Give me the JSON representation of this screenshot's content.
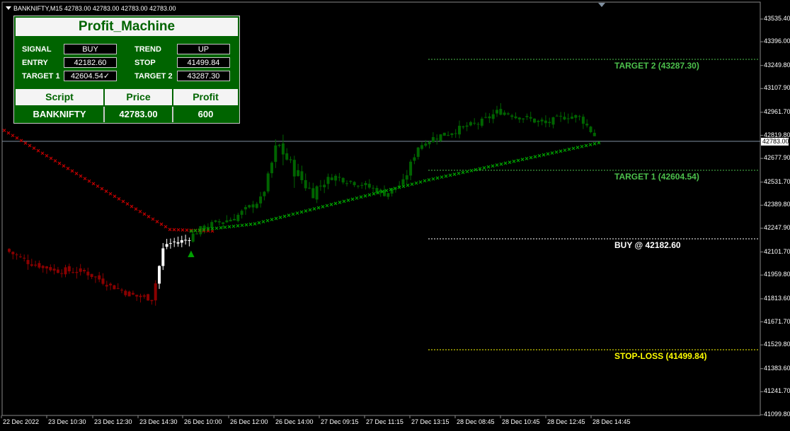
{
  "header": {
    "symbol_info": "BANKNIFTY,M15  42783.00 42783.00 42783.00 42783.00"
  },
  "panel": {
    "title": "Profit_Machine",
    "signal_label": "SIGNAL",
    "signal_value": "BUY",
    "trend_label": "TREND",
    "trend_value": "UP",
    "entry_label": "ENTRY",
    "entry_value": "42182.60",
    "stop_label": "STOP",
    "stop_value": "41499.84",
    "target1_label": "TARGET 1",
    "target1_value": "42604.54✓",
    "target2_label": "TARGET 2",
    "target2_value": "43287.30",
    "table": {
      "headers": [
        "Script",
        "Price",
        "Profit"
      ],
      "row": [
        "BANKNIFTY",
        "42783.00",
        "600"
      ]
    }
  },
  "levels": {
    "target2": {
      "label": "TARGET 2 (43287.30)",
      "price": 43287.3,
      "color": "#4cc04c"
    },
    "target1": {
      "label": "TARGET 1 (42604.54)",
      "price": 42604.54,
      "color": "#4cc04c"
    },
    "buy": {
      "label": "BUY @ 42182.60",
      "price": 42182.6,
      "color": "#ffffff"
    },
    "stop": {
      "label": "STOP-LOSS (41499.84)",
      "price": 41499.84,
      "color": "#ffff00"
    }
  },
  "current_price": {
    "label": "42783.00",
    "value": 42783.0
  },
  "y_axis": {
    "labels": [
      "43535.40",
      "43396.00",
      "43249.80",
      "43107.90",
      "42961.70",
      "42819.80",
      "42677.90",
      "42531.70",
      "42389.80",
      "42247.90",
      "42101.70",
      "41959.80",
      "41813.60",
      "41671.70",
      "41529.80",
      "41383.60",
      "41241.70",
      "41099.80"
    ],
    "min": 41099.8,
    "max": 43535.4
  },
  "x_axis": {
    "labels": [
      "22 Dec 2022",
      "23 Dec 10:30",
      "23 Dec 12:30",
      "23 Dec 14:30",
      "26 Dec 10:00",
      "26 Dec 12:00",
      "26 Dec 14:00",
      "27 Dec 09:15",
      "27 Dec 11:15",
      "27 Dec 13:15",
      "28 Dec 08:45",
      "28 Dec 10:45",
      "28 Dec 12:45",
      "28 Dec 14:45"
    ]
  },
  "colors": {
    "bull": "#006400",
    "bear": "#8b0000",
    "signal_white": "#ffffff",
    "sar_bear": "#c00000",
    "sar_bull": "#00a000"
  }
}
